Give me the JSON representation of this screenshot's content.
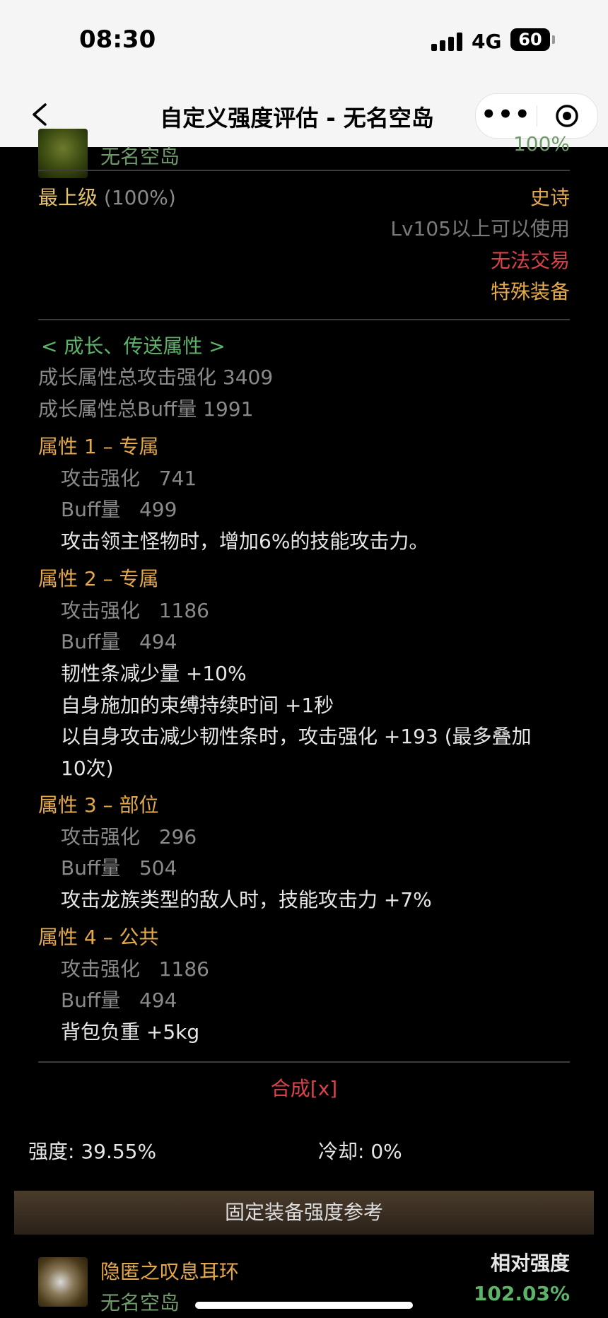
{
  "status": {
    "time": "08:30",
    "network": "4G",
    "battery": "60"
  },
  "nav": {
    "title": "自定义强度评估 - 无名空岛",
    "more_label": "•••"
  },
  "item_header": {
    "island": "无名空岛",
    "percent_partial": "100%"
  },
  "meta": {
    "grade_label": "最上级",
    "grade_value": "(100%)",
    "rarity": "史诗",
    "level_req": "Lv105以上可以使用",
    "trade": "无法交易",
    "type": "特殊装备"
  },
  "growth": {
    "section_title": "< 成长、传送属性 >",
    "total_attack": "成长属性总攻击强化 3409",
    "total_buff": "成长属性总Buff量 1991"
  },
  "attributes": [
    {
      "title": "属性 1 – 专属",
      "attack": "攻击强化   741",
      "buff": "Buff量   499",
      "effects": [
        "攻击领主怪物时，增加6%的技能攻击力。"
      ]
    },
    {
      "title": "属性 2 – 专属",
      "attack": "攻击强化   1186",
      "buff": "Buff量   494",
      "effects": [
        "韧性条减少量 +10%",
        "自身施加的束缚持续时间 +1秒",
        "以自身攻击减少韧性条时，攻击强化 +193 (最多叠加",
        "10次)"
      ]
    },
    {
      "title": "属性 3 – 部位",
      "attack": "攻击强化   296",
      "buff": "Buff量   504",
      "effects": [
        "攻击龙族类型的敌人时，技能攻击力 +7%"
      ]
    },
    {
      "title": "属性 4 – 公共",
      "attack": "攻击强化   1186",
      "buff": "Buff量   494",
      "effects": [
        "背包负重 +5kg"
      ]
    }
  ],
  "synthesis": "合成[x]",
  "stats": {
    "strength": "强度: 39.55%",
    "cooldown": "冷却: 0%"
  },
  "reference": {
    "bar_title": "固定装备强度参考",
    "item_name": "隐匿之叹息耳环",
    "item_island": "无名空岛",
    "relative_label": "相对强度",
    "relative_value": "102.03%"
  }
}
